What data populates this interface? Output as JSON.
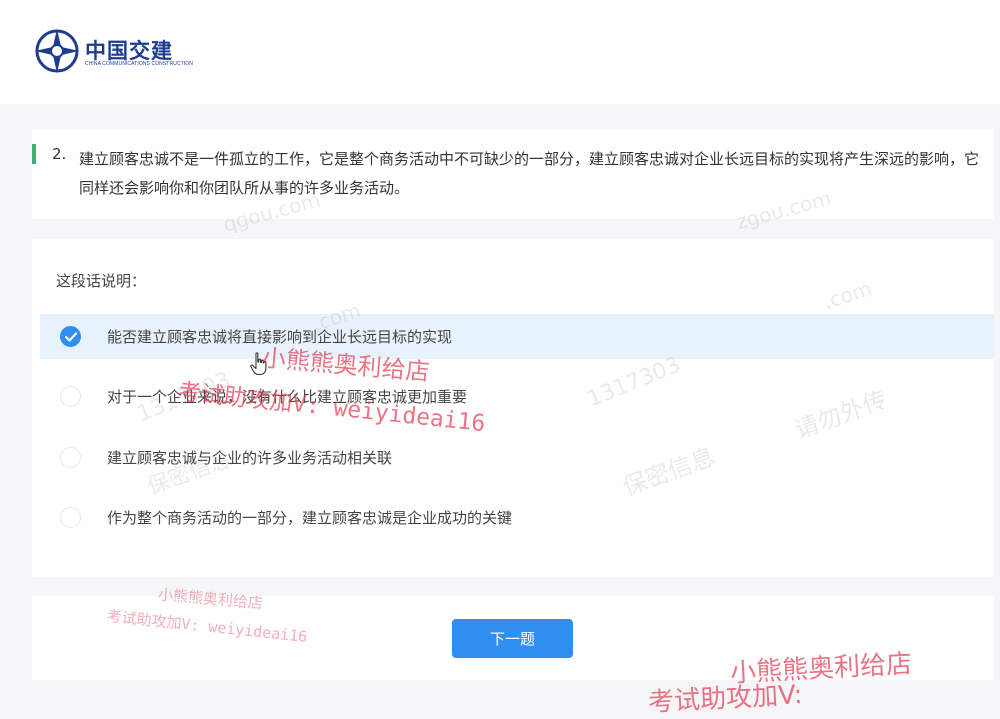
{
  "header": {
    "logo_cn": "中国交建",
    "logo_en": "CHINA COMMUNICATIONS CONSTRUCTION"
  },
  "question": {
    "number": "2.",
    "text": "建立顾客忠诚不是一件孤立的工作，它是整个商务活动中不可缺少的一部分，建立顾客忠诚对企业长远目标的实现将产生深远的影响，它同样还会影响你和你团队所从事的许多业务活动。"
  },
  "prompt": "这段话说明：",
  "options": [
    {
      "label": "能否建立顾客忠诚将直接影响到企业长远目标的实现",
      "selected": true
    },
    {
      "label": "对于一个企业来说，没有什么比建立顾客忠诚更加重要",
      "selected": false
    },
    {
      "label": "建立顾客忠诚与企业的许多业务活动相关联",
      "selected": false
    },
    {
      "label": "作为整个商务活动的一部分，建立顾客忠诚是企业成功的关键",
      "selected": false
    }
  ],
  "next_button": "下一题",
  "watermarks": {
    "shop": "小熊熊奥利给店",
    "contact": "考试助攻加V: weiyideai16",
    "contact_cut": "考试助攻加V:",
    "phone": "1317303",
    "notice": "请勿外传",
    "secret": "保密信息",
    "domain1": ".com",
    "domain2": "zgou.com",
    "domain3": "qgou.com"
  },
  "colors": {
    "primary": "#2f8ff0",
    "accent_bar": "#3cb371",
    "selected_bg": "#e8f2fd",
    "logo": "#1d3d8f",
    "watermark": "#e23e56"
  }
}
